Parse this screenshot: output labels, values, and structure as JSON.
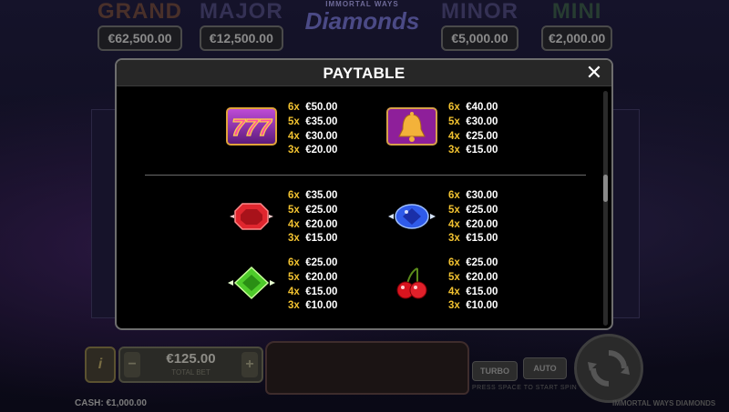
{
  "jackpots": [
    {
      "name": "GRAND",
      "value": "€62,500.00"
    },
    {
      "name": "MAJOR",
      "value": "€12,500.00"
    },
    {
      "name": "MINOR",
      "value": "€5,000.00"
    },
    {
      "name": "MINI",
      "value": "€2,000.00"
    }
  ],
  "logo": {
    "small": "IMMORTAL WAYS",
    "big": "Diamonds"
  },
  "dialog": {
    "title": "PAYTABLE",
    "close_icon": "close-icon"
  },
  "symbols": [
    {
      "icon": "sevens-icon",
      "pays": [
        {
          "m": "6x",
          "v": "€50.00"
        },
        {
          "m": "5x",
          "v": "€35.00"
        },
        {
          "m": "4x",
          "v": "€30.00"
        },
        {
          "m": "3x",
          "v": "€20.00"
        }
      ]
    },
    {
      "icon": "bell-icon",
      "pays": [
        {
          "m": "6x",
          "v": "€40.00"
        },
        {
          "m": "5x",
          "v": "€30.00"
        },
        {
          "m": "4x",
          "v": "€25.00"
        },
        {
          "m": "3x",
          "v": "€15.00"
        }
      ]
    },
    {
      "icon": "red-gem-icon",
      "pays": [
        {
          "m": "6x",
          "v": "€35.00"
        },
        {
          "m": "5x",
          "v": "€25.00"
        },
        {
          "m": "4x",
          "v": "€20.00"
        },
        {
          "m": "3x",
          "v": "€15.00"
        }
      ]
    },
    {
      "icon": "blue-diamond-icon",
      "pays": [
        {
          "m": "6x",
          "v": "€30.00"
        },
        {
          "m": "5x",
          "v": "€25.00"
        },
        {
          "m": "4x",
          "v": "€20.00"
        },
        {
          "m": "3x",
          "v": "€15.00"
        }
      ]
    },
    {
      "icon": "green-gem-icon",
      "pays": [
        {
          "m": "6x",
          "v": "€25.00"
        },
        {
          "m": "5x",
          "v": "€20.00"
        },
        {
          "m": "4x",
          "v": "€15.00"
        },
        {
          "m": "3x",
          "v": "€10.00"
        }
      ]
    },
    {
      "icon": "cherries-icon",
      "pays": [
        {
          "m": "6x",
          "v": "€25.00"
        },
        {
          "m": "5x",
          "v": "€20.00"
        },
        {
          "m": "4x",
          "v": "€15.00"
        },
        {
          "m": "3x",
          "v": "€10.00"
        }
      ]
    }
  ],
  "bottom": {
    "info_label": "i",
    "stake_value": "€125.00",
    "stake_label": "TOTAL BET",
    "minus_label": "−",
    "plus_label": "+",
    "win_label": "",
    "turbo_label": "TURBO",
    "auto_label": "AUTO",
    "hint": "PRESS SPACE TO START SPIN",
    "cash": "CASH: €1,000.00",
    "game_name": "IMMORTAL WAYS DIAMONDS"
  }
}
